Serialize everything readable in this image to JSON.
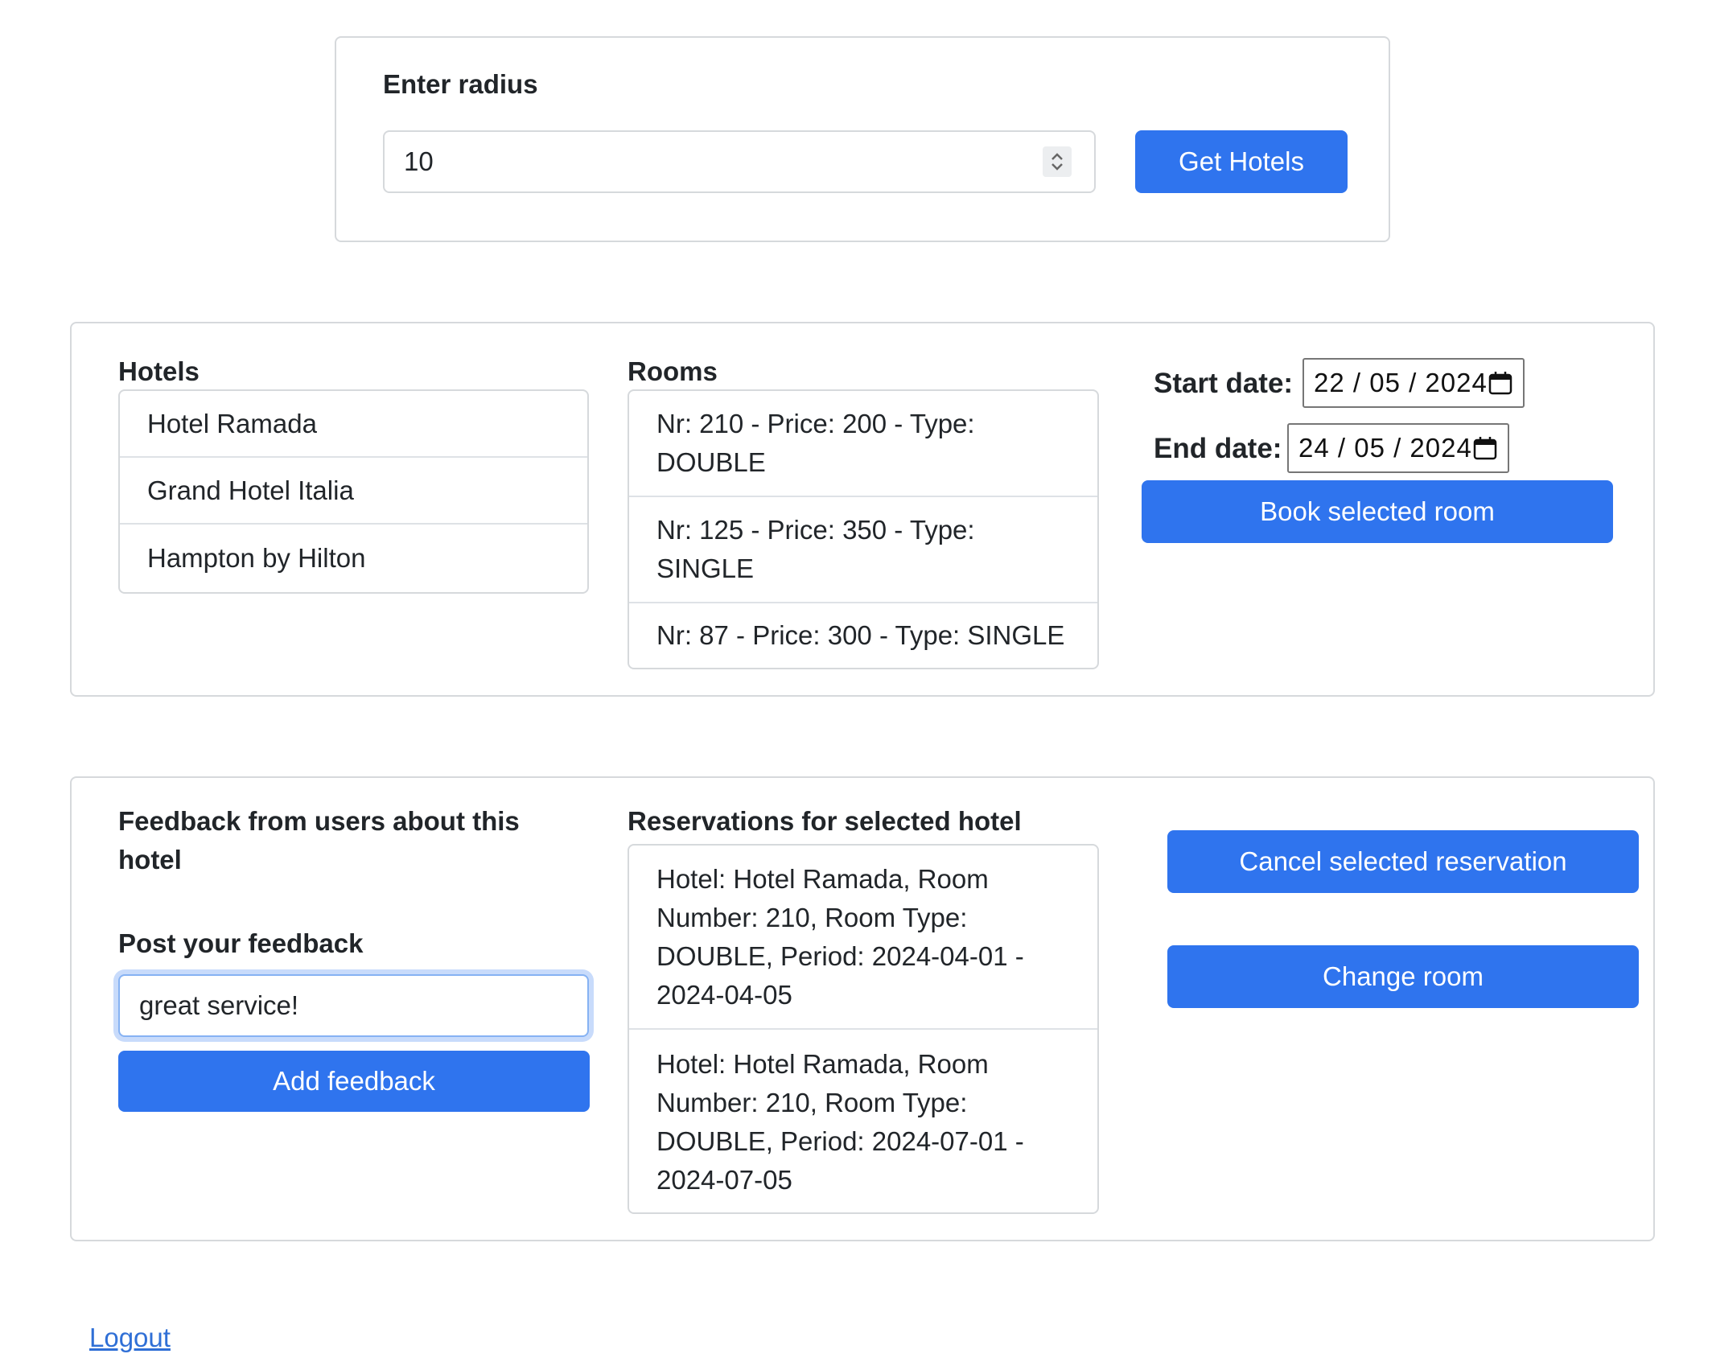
{
  "radius": {
    "label": "Enter radius",
    "value": "10",
    "button": "Get Hotels"
  },
  "hotels": {
    "heading": "Hotels",
    "items": [
      "Hotel Ramada",
      "Grand Hotel Italia",
      "Hampton by Hilton"
    ]
  },
  "rooms": {
    "heading": "Rooms",
    "items": [
      "Nr: 210 - Price: 200 - Type: DOUBLE",
      "Nr: 125 - Price: 350 - Type: SINGLE",
      "Nr: 87 - Price: 300 - Type: SINGLE"
    ]
  },
  "booking": {
    "start_label": "Start date:",
    "start_value": "22 / 05 / 2024",
    "end_label": "End date:",
    "end_value": "24 / 05 / 2024",
    "book_button": "Book selected room"
  },
  "feedback": {
    "heading": "Feedback from users about this hotel",
    "post_heading": "Post your feedback",
    "input_value": "great service!",
    "add_button": "Add feedback"
  },
  "reservations": {
    "heading": "Reservations for selected hotel",
    "items": [
      "Hotel: Hotel Ramada, Room Number: 210, Room Type: DOUBLE, Period: 2024-04-01 - 2024-04-05",
      "Hotel: Hotel Ramada, Room Number: 210, Room Type: DOUBLE, Period: 2024-07-01 - 2024-07-05"
    ],
    "cancel_button": "Cancel selected reservation",
    "change_button": "Change room"
  },
  "logout": "Logout",
  "colors": {
    "primary": "#2f74ee",
    "link": "#2f6fd6",
    "border": "#d6d9dc",
    "focus_ring": "#b6cff8"
  }
}
